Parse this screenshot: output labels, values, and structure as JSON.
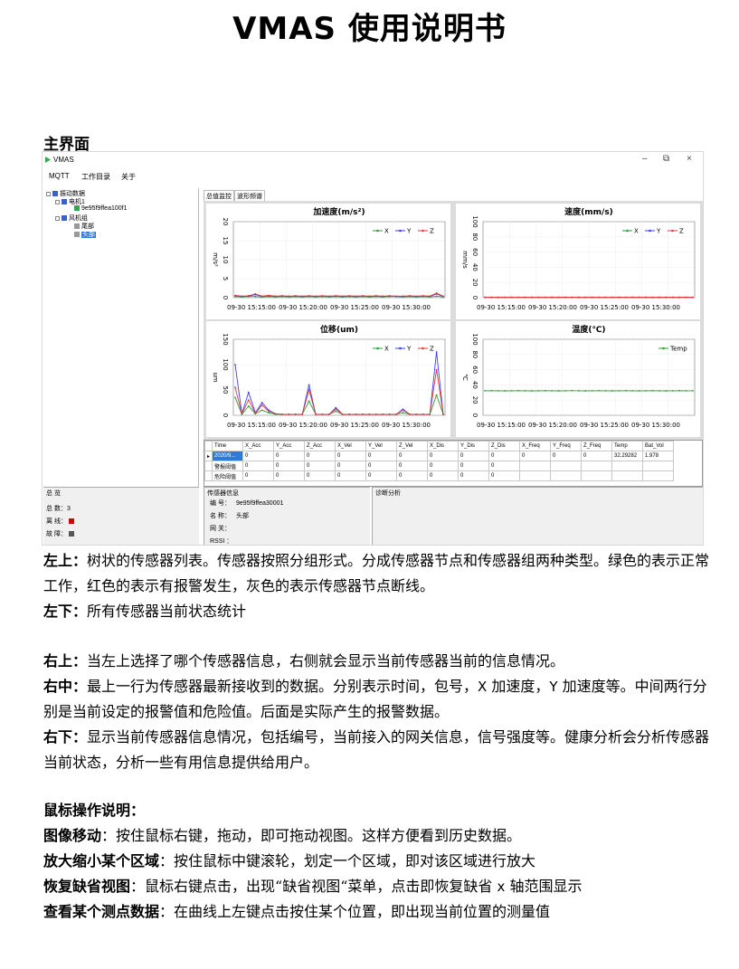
{
  "doc": {
    "title": "VMAS 使用说明书"
  },
  "section": {
    "main_ui": "主界面"
  },
  "app": {
    "window_title": "VMAS",
    "window_controls": {
      "minimize": "–",
      "restore": "⧉",
      "close": "×"
    },
    "menu": [
      "MQTT",
      "工作目录",
      "关于"
    ],
    "tree": {
      "root": "振动数据",
      "group1": "电机1",
      "node1": "9e95f9ffea100f1",
      "group2": "风机组",
      "node2": "尾部",
      "node3": "头部"
    },
    "tabs": [
      "总值监控",
      "波形频谱"
    ],
    "legend_xyz": [
      "X",
      "Y",
      "Z"
    ],
    "legend_temp": "Temp",
    "x_ticks": [
      "09-30 15:15:00",
      "09-30 15:20:00",
      "09-30 15:25:00",
      "09-30 15:30:00"
    ],
    "table": {
      "headers": [
        "Time",
        "X_Acc",
        "Y_Acc",
        "Z_Acc",
        "X_Vel",
        "Y_Vel",
        "Z_Vel",
        "X_Dis",
        "Y_Dis",
        "Z_Dis",
        "X_Freq",
        "Y_Freq",
        "Z_Freq",
        "Temp",
        "Bat_Vol"
      ],
      "rows": [
        [
          "2020/9...",
          "0",
          "0",
          "0",
          "0",
          "0",
          "0",
          "0",
          "0",
          "0",
          "0",
          "0",
          "0",
          "32.29282",
          "1.978"
        ],
        [
          "警报阈值",
          "0",
          "0",
          "0",
          "0",
          "0",
          "0",
          "0",
          "0",
          "0",
          "",
          "",
          "",
          "",
          ""
        ],
        [
          "危险阈值",
          "0",
          "0",
          "0",
          "0",
          "0",
          "0",
          "0",
          "0",
          "0",
          "",
          "",
          "",
          "",
          ""
        ]
      ]
    },
    "summary": {
      "title": "总 览",
      "total_label": "总 数：",
      "total_value": "3",
      "offline_label": "离 线：",
      "fault_label": "故 障："
    },
    "sensor_info": {
      "title": "传感器信息",
      "id_label": "编 号：",
      "id_value": "9e95f9ffea30001",
      "name_label": "名 称：",
      "name_value": "头部",
      "gateway_label": "网 关：",
      "gateway_value": "",
      "rssi_label": "RSSI ：",
      "rssi_value": ""
    },
    "diagnosis": {
      "title": "诊断分析"
    },
    "colors": {
      "x": "#2a9d3a",
      "y": "#3b3bff",
      "z": "#e23b3b",
      "offline": "#d00000",
      "fault": "#555555"
    }
  },
  "chart_data": [
    {
      "type": "line",
      "title": "加速度(m/s²)",
      "ylabel": "m/s²",
      "ylim": [
        0,
        20
      ],
      "yticks": [
        0,
        5,
        10,
        15,
        20
      ],
      "x": [
        "09-30 15:15:00",
        "09-30 15:20:00",
        "09-30 15:25:00",
        "09-30 15:30:00"
      ],
      "series": [
        {
          "name": "X",
          "values": [
            0.3,
            0.2,
            0.3,
            0.3,
            0.2,
            0.3,
            0.2,
            0.3,
            0.2,
            0.3,
            0.2,
            0.3,
            0.2,
            0.3,
            0.2,
            0.3,
            0.2,
            0.3,
            0.2,
            0.3,
            0.2,
            0.3,
            0.2,
            0.3,
            0.3,
            0.2,
            0.3,
            0.2,
            0.3,
            0.2,
            0.4,
            0.2
          ]
        },
        {
          "name": "Y",
          "values": [
            0.5,
            0.3,
            0.4,
            0.8,
            0.3,
            0.5,
            0.3,
            0.4,
            0.3,
            0.4,
            0.3,
            0.4,
            0.3,
            0.4,
            0.3,
            0.4,
            0.3,
            0.4,
            0.3,
            0.4,
            0.3,
            0.4,
            0.3,
            0.4,
            0.3,
            0.3,
            0.4,
            0.3,
            0.4,
            0.3,
            1.0,
            0.3
          ]
        },
        {
          "name": "Z",
          "values": [
            0.6,
            0.4,
            0.5,
            1.0,
            0.4,
            0.6,
            0.4,
            0.5,
            0.4,
            0.5,
            0.4,
            0.5,
            0.4,
            0.5,
            0.4,
            0.5,
            0.4,
            0.5,
            0.4,
            0.5,
            0.4,
            0.5,
            0.4,
            0.5,
            0.4,
            0.4,
            0.5,
            0.4,
            0.5,
            0.4,
            1.2,
            0.4
          ]
        }
      ]
    },
    {
      "type": "line",
      "title": "速度(mm/s)",
      "ylabel": "mm/s",
      "ylim": [
        0,
        100
      ],
      "yticks": [
        0,
        20,
        40,
        60,
        80,
        100
      ],
      "x": [
        "09-30 15:15:00",
        "09-30 15:20:00",
        "09-30 15:25:00",
        "09-30 15:30:00"
      ],
      "series": [
        {
          "name": "X",
          "values": [
            0.3,
            0.3,
            0.3,
            0.3,
            0.3,
            0.3,
            0.3,
            0.3,
            0.3,
            0.3,
            0.3,
            0.3,
            0.3,
            0.3,
            0.3,
            0.3,
            0.3,
            0.3,
            0.3,
            0.3,
            0.3,
            0.3,
            0.3,
            0.3,
            0.3,
            0.3,
            0.3,
            0.3,
            0.3,
            0.3,
            0.3,
            0.3
          ]
        },
        {
          "name": "Y",
          "values": [
            0.5,
            0.4,
            0.5,
            0.4,
            0.5,
            0.4,
            0.5,
            0.4,
            0.5,
            0.4,
            0.5,
            0.4,
            0.5,
            0.4,
            0.5,
            0.4,
            0.5,
            0.4,
            0.5,
            0.4,
            0.5,
            0.4,
            0.5,
            0.4,
            0.5,
            0.4,
            0.5,
            0.4,
            0.5,
            0.4,
            0.5,
            0.4
          ]
        },
        {
          "name": "Z",
          "values": [
            0.6,
            0.5,
            0.6,
            0.5,
            0.6,
            0.5,
            0.6,
            0.5,
            0.6,
            0.5,
            0.6,
            0.5,
            0.6,
            0.5,
            0.6,
            0.5,
            0.6,
            0.5,
            0.6,
            0.5,
            0.6,
            0.5,
            0.6,
            0.5,
            0.6,
            0.5,
            0.6,
            0.5,
            0.6,
            0.5,
            0.6,
            0.5
          ]
        }
      ]
    },
    {
      "type": "line",
      "title": "位移(um)",
      "ylabel": "um",
      "ylim": [
        0,
        150
      ],
      "yticks": [
        0,
        50,
        100,
        150
      ],
      "x": [
        "09-30 15:15:00",
        "09-30 15:20:00",
        "09-30 15:25:00",
        "09-30 15:30:00"
      ],
      "series": [
        {
          "name": "X",
          "values": [
            35,
            2,
            18,
            3,
            10,
            5,
            2,
            2,
            2,
            2,
            2,
            28,
            2,
            2,
            2,
            8,
            2,
            2,
            2,
            2,
            2,
            2,
            2,
            2,
            2,
            5,
            2,
            2,
            2,
            2,
            40,
            2
          ]
        },
        {
          "name": "Y",
          "values": [
            100,
            3,
            45,
            5,
            25,
            10,
            3,
            2,
            2,
            2,
            2,
            60,
            2,
            2,
            2,
            15,
            2,
            2,
            2,
            2,
            2,
            2,
            2,
            2,
            2,
            12,
            2,
            2,
            2,
            2,
            125,
            2
          ]
        },
        {
          "name": "Z",
          "values": [
            55,
            3,
            30,
            4,
            20,
            8,
            3,
            2,
            2,
            2,
            2,
            50,
            2,
            2,
            2,
            12,
            2,
            2,
            2,
            2,
            2,
            2,
            2,
            2,
            2,
            10,
            2,
            2,
            2,
            2,
            90,
            2
          ]
        }
      ]
    },
    {
      "type": "line",
      "title": "温度(℃)",
      "ylabel": "℃",
      "ylim": [
        0,
        100
      ],
      "yticks": [
        0,
        20,
        40,
        60,
        80,
        100
      ],
      "x": [
        "09-30 15:15:00",
        "09-30 15:20:00",
        "09-30 15:25:00",
        "09-30 15:30:00"
      ],
      "series": [
        {
          "name": "Temp",
          "values": [
            32.3,
            32.4,
            32.3,
            32.2,
            32.3,
            32.4,
            32.3,
            32.2,
            32.3,
            32.4,
            32.3,
            32.2,
            32.3,
            32.4,
            32.3,
            32.2,
            32.3,
            32.4,
            32.3,
            32.2,
            32.3,
            32.4,
            32.3,
            32.2,
            32.3,
            32.4,
            32.3,
            32.2,
            32.3,
            32.4,
            32.3,
            32.3
          ]
        }
      ]
    }
  ],
  "text": {
    "p1_label": "左上：",
    "p1": "树状的传感器列表。传感器按照分组形式。分成传感器节点和传感器组两种类型。绿色的表示正常工作，红色的表示有报警发生，灰色的表示传感器节点断线。",
    "p2_label": "左下：",
    "p2": "所有传感器当前状态统计",
    "p3_label": "右上：",
    "p3": "当左上选择了哪个传感器信息，右侧就会显示当前传感器当前的信息情况。",
    "p4_label": "右中：",
    "p4a": "最上一行为传感器最新接收到的数据。分别表示时间，包号，",
    "p4_x": "X",
    "p4b": " 加速度，",
    "p4_y": "Y",
    "p4c": " 加速度等。中间两行分别是当前设定的报警值和危险值。后面是实际产生的报警数据。",
    "p5_label": "右下：",
    "p5": "显示当前传感器信息情况，包括编号，当前接入的网关信息，信号强度等。健康分析会分析传感器当前状态，分析一些有用信息提供给用户。",
    "mouse_title": "鼠标操作说明：",
    "m1_label": "图像移动",
    "m1": "：按住鼠标右键，拖动，即可拖动视图。这样方便看到历史数据。",
    "m2_label": "放大缩小某个区域",
    "m2": "：按住鼠标中键滚轮，划定一个区域，即对该区域进行放大",
    "m3_label": "恢复缺省视图",
    "m3a": "：鼠标右键点击，出现“缺省视图“菜单，点击即恢复缺省 ",
    "m3_x": "x",
    "m3b": " 轴范围显示",
    "m4_label": "查看某个测点数据",
    "m4": "：在曲线上左键点击按住某个位置，即出现当前位置的测量值"
  }
}
